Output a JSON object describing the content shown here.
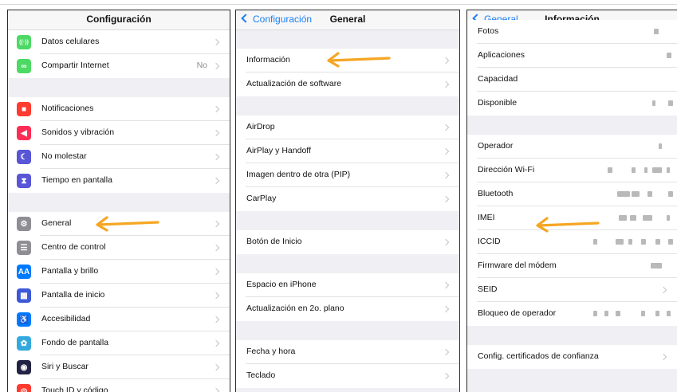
{
  "panel1": {
    "title": "Configuración",
    "group1": [
      {
        "label": "Datos celulares",
        "icon": "antenna-icon",
        "color": "#4cd964"
      },
      {
        "label": "Compartir Internet",
        "icon": "hotspot-icon",
        "color": "#4cd964",
        "value": "No"
      }
    ],
    "group2": [
      {
        "label": "Notificaciones",
        "icon": "notifications-icon",
        "color": "#ff3b30"
      },
      {
        "label": "Sonidos y vibración",
        "icon": "speaker-icon",
        "color": "#ff2d55"
      },
      {
        "label": "No molestar",
        "icon": "moon-icon",
        "color": "#5856d6"
      },
      {
        "label": "Tiempo en pantalla",
        "icon": "hourglass-icon",
        "color": "#5856d6"
      }
    ],
    "group3": [
      {
        "label": "General",
        "icon": "gear-icon",
        "color": "#8e8e93"
      },
      {
        "label": "Centro de control",
        "icon": "toggles-icon",
        "color": "#8e8e93"
      },
      {
        "label": "Pantalla y brillo",
        "icon": "text-size-icon",
        "color": "#007aff",
        "glyph": "AA"
      },
      {
        "label": "Pantalla de inicio",
        "icon": "home-grid-icon",
        "color": "#3d58d8"
      },
      {
        "label": "Accesibilidad",
        "icon": "accessibility-icon",
        "color": "#007aff"
      },
      {
        "label": "Fondo de pantalla",
        "icon": "wallpaper-icon",
        "color": "#34aadc"
      },
      {
        "label": "Siri y Buscar",
        "icon": "siri-icon",
        "color": "#222244"
      },
      {
        "label": "Touch ID y código",
        "icon": "fingerprint-icon",
        "color": "#ff3b30"
      }
    ]
  },
  "panel2": {
    "back": "Configuración",
    "title": "General",
    "groups": [
      [
        "Información",
        "Actualización de software"
      ],
      [
        "AirDrop",
        "AirPlay y Handoff",
        "Imagen dentro de otra (PIP)",
        "CarPlay"
      ],
      [
        "Botón de Inicio"
      ],
      [
        "Espacio en iPhone",
        "Actualización en 2o. plano"
      ],
      [
        "Fecha y hora",
        "Teclado"
      ]
    ]
  },
  "panel3": {
    "back": "General",
    "title": "Información",
    "group1": [
      "Fotos",
      "Aplicaciones",
      "Capacidad",
      "Disponible"
    ],
    "group2": [
      "Operador",
      "Dirección Wi-Fi",
      "Bluetooth",
      "IMEI",
      "ICCID",
      "Firmware del módem",
      "SEID",
      "Bloqueo de operador"
    ],
    "group3": [
      "Config. certificados de confianza"
    ]
  },
  "colors": {
    "accent": "#1a7ef5",
    "arrow": "#f5a623"
  }
}
